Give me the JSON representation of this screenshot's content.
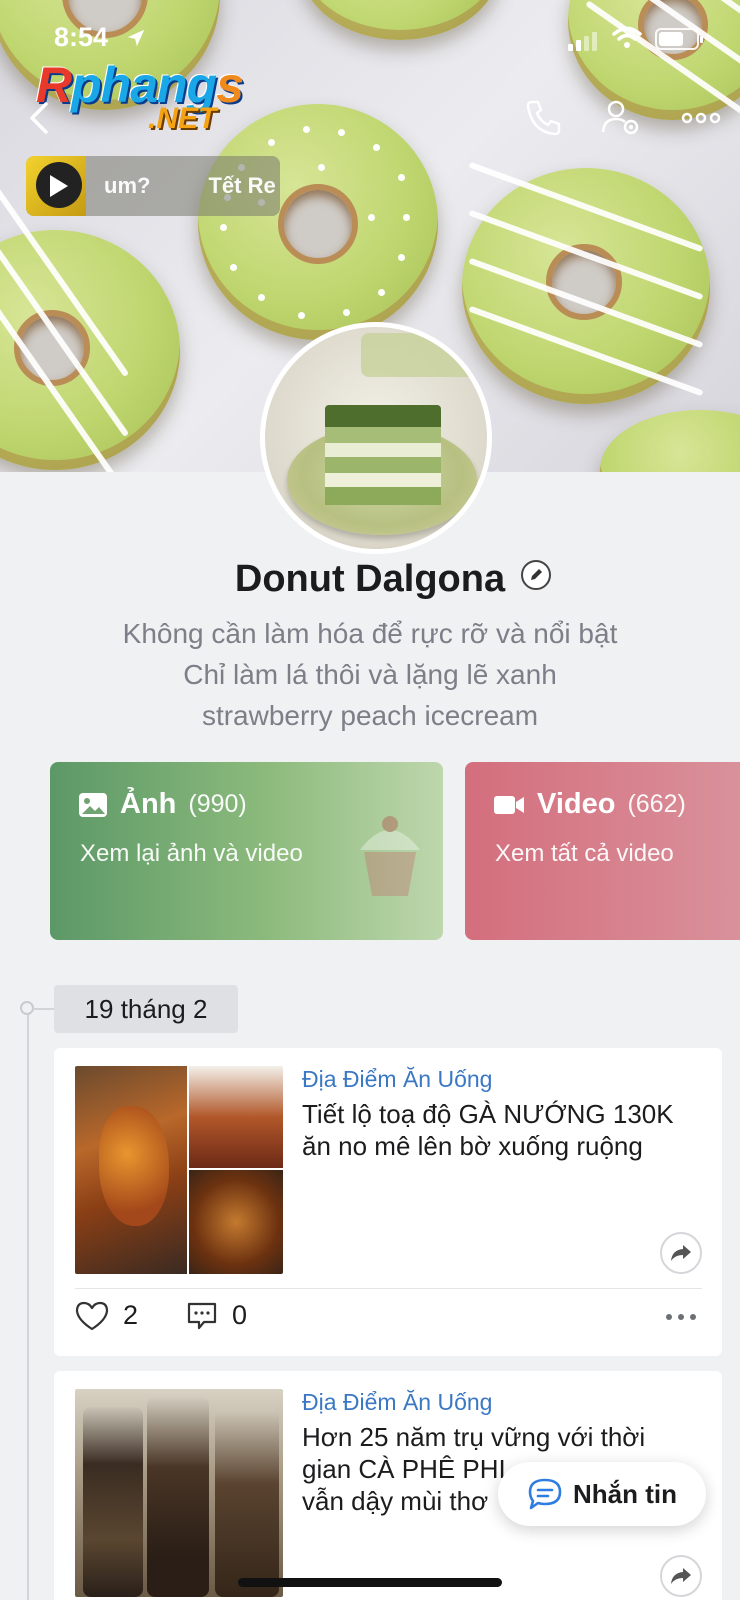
{
  "status_bar": {
    "time": "8:54"
  },
  "watermark": {
    "brand": "Rphangs",
    "suffix": ".NET"
  },
  "music": {
    "snippet_1": "um?",
    "snippet_2": "Tết Re"
  },
  "profile": {
    "name": "Donut Dalgona",
    "bio_lines": [
      "Không cần làm hóa để rực rỡ và nổi bật",
      "Chỉ làm lá thôi và lặng lẽ xanh",
      "strawberry peach icecream"
    ]
  },
  "cards": {
    "photo": {
      "label": "Ảnh",
      "count": "(990)",
      "subtitle": "Xem lại ảnh và video",
      "color": "#5c9867"
    },
    "video": {
      "label": "Video",
      "count": "(662)",
      "subtitle": "Xem tất cả video",
      "color": "#d46e7d"
    }
  },
  "timeline": {
    "date": "19 tháng 2",
    "posts": [
      {
        "category": "Địa Điểm Ăn Uống",
        "headline": "Tiết lộ toạ độ GÀ NƯỚNG 130K ăn no mê lên bờ xuống ruộng",
        "likes": "2",
        "comments": "0"
      },
      {
        "category": "Địa Điểm Ăn Uống",
        "headline": "Hơn 25 năm trụ vững với thời gian CÀ PHÊ PHI",
        "headline_line3": "vẫn dậy mùi thơ"
      }
    ]
  },
  "chat_fab": {
    "label": "Nhắn tin"
  },
  "colors": {
    "accent_blue": "#3a78c3",
    "background": "#f0f1f3"
  }
}
